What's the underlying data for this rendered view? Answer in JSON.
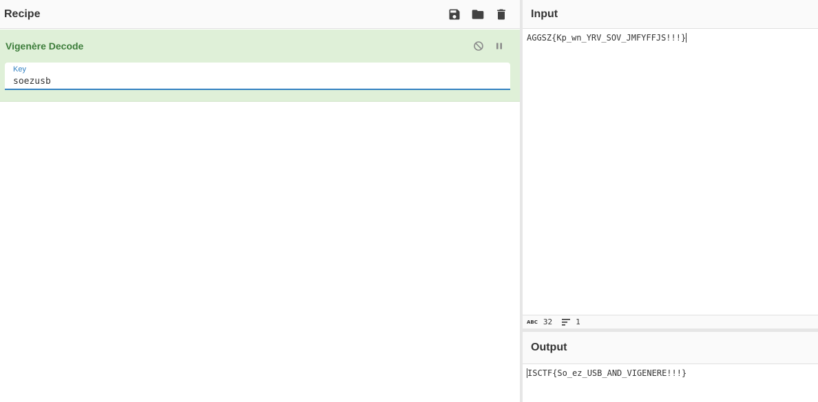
{
  "recipe": {
    "title": "Recipe",
    "icons": {
      "save": "save-icon",
      "load": "folder-icon",
      "clear": "trash-icon"
    }
  },
  "operation": {
    "name": "Vigenère Decode",
    "key_label": "Key",
    "key_value": "soezusb",
    "accent_color": "#3c7d3a",
    "background_color": "#dff0d8"
  },
  "input": {
    "title": "Input",
    "text": "AGGSZ{Kp_wn_YRV_SOV_JMFYFFJS!!!}",
    "length": "32",
    "lines": "1"
  },
  "output": {
    "title": "Output",
    "text": "ISCTF{So_ez_USB_AND_VIGENERE!!!}"
  }
}
